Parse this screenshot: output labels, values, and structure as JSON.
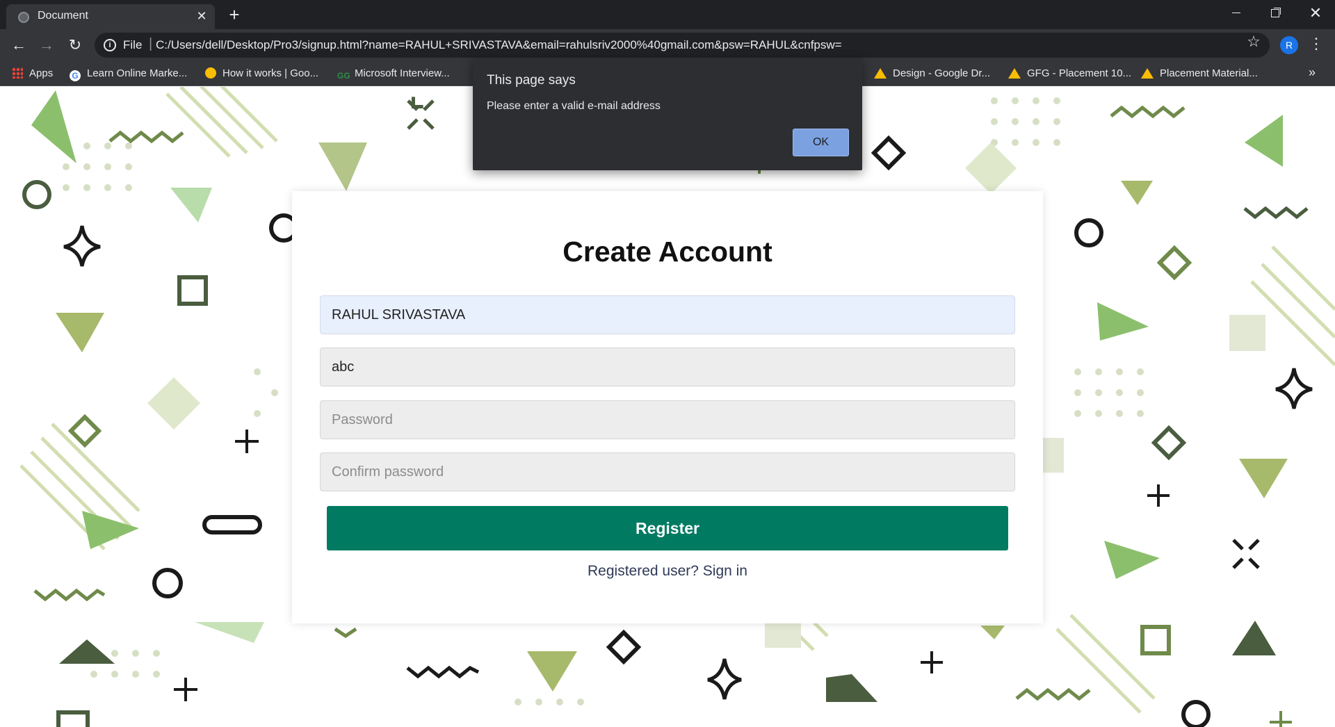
{
  "browser": {
    "tab_title": "Document",
    "tab_close": "✕",
    "new_tab": "+",
    "url_scheme": "File",
    "url": "C:/Users/dell/Desktop/Pro3/signup.html?name=RAHUL+SRIVASTAVA&email=rahulsriv2000%40gmail.com&psw=RAHUL&cnfpsw=",
    "profile_initial": "R",
    "bookmarks": [
      {
        "label": "Apps",
        "icon": "apps-grid-icon"
      },
      {
        "label": "Learn Online Marke...",
        "icon": "google-icon"
      },
      {
        "label": "How it works | Goo...",
        "icon": "sun-icon"
      },
      {
        "label": "Microsoft Interview...",
        "icon": "gfg-icon"
      },
      {
        "label": "Design - Google Dr...",
        "icon": "google-drive-icon"
      },
      {
        "label": "GFG - Placement 10...",
        "icon": "google-drive-icon"
      },
      {
        "label": "Placement Material...",
        "icon": "google-drive-icon"
      }
    ],
    "more_bookmarks": "»"
  },
  "alert": {
    "title": "This page says",
    "message": "Please enter a valid e-mail address",
    "ok_label": "OK"
  },
  "form": {
    "title": "Create Account",
    "name_value": "RAHUL SRIVASTAVA",
    "email_value": "abc",
    "password_placeholder": "Password",
    "confirm_placeholder": "Confirm password",
    "register_label": "Register",
    "signin_text": "Registered user? Sign in"
  },
  "colors": {
    "accent": "#007b62",
    "alert_bg": "#2d2e31",
    "shape_light": "#c8d8a4",
    "shape_mid": "#8cbf6c",
    "shape_dark": "#4a5d3f"
  }
}
